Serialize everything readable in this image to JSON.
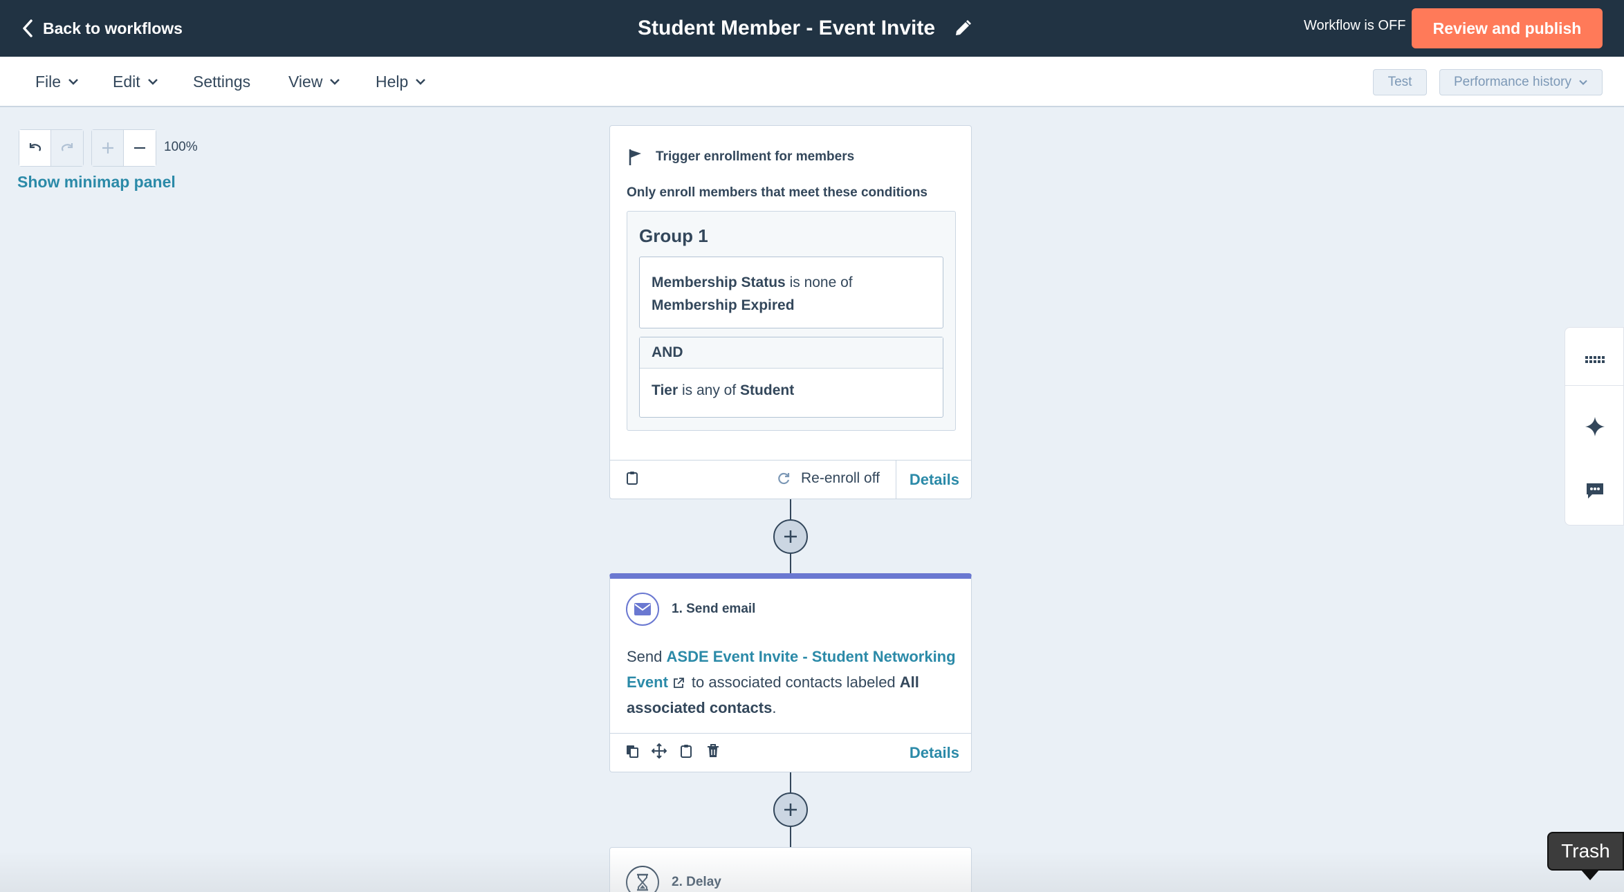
{
  "topbar": {
    "back_label": "Back to workflows",
    "title": "Student Member - Event Invite",
    "status": "Workflow is OFF",
    "publish_label": "Review and publish",
    "accent_color": "#ff7a59"
  },
  "menu": {
    "items": [
      "File",
      "Edit",
      "Settings",
      "View",
      "Help"
    ],
    "test_label": "Test",
    "history_label": "Performance history"
  },
  "canvas": {
    "zoom": "100%",
    "minimap_label": "Show minimap panel"
  },
  "trigger": {
    "heading": "Trigger enrollment for members",
    "subheading": "Only enroll members that meet these conditions",
    "group_title": "Group 1",
    "cond1_prop": "Membership Status",
    "cond1_op": "is none of",
    "cond1_val": "Membership Expired",
    "and_label": "AND",
    "cond2_prop": "Tier",
    "cond2_op": "is any of",
    "cond2_val": "Student",
    "reenroll": "Re-enroll off",
    "details": "Details"
  },
  "email_action": {
    "heading": "1. Send email",
    "send_prefix": "Send",
    "email_name": "ASDE Event Invite - Student Networking Event",
    "mid_text": "to associated contacts labeled",
    "label_name": "All associated contacts",
    "end_text": ".",
    "details": "Details",
    "accent_color": "#6a78d1"
  },
  "delay_action": {
    "heading": "2. Delay"
  },
  "tooltip": {
    "text": "Trash"
  }
}
